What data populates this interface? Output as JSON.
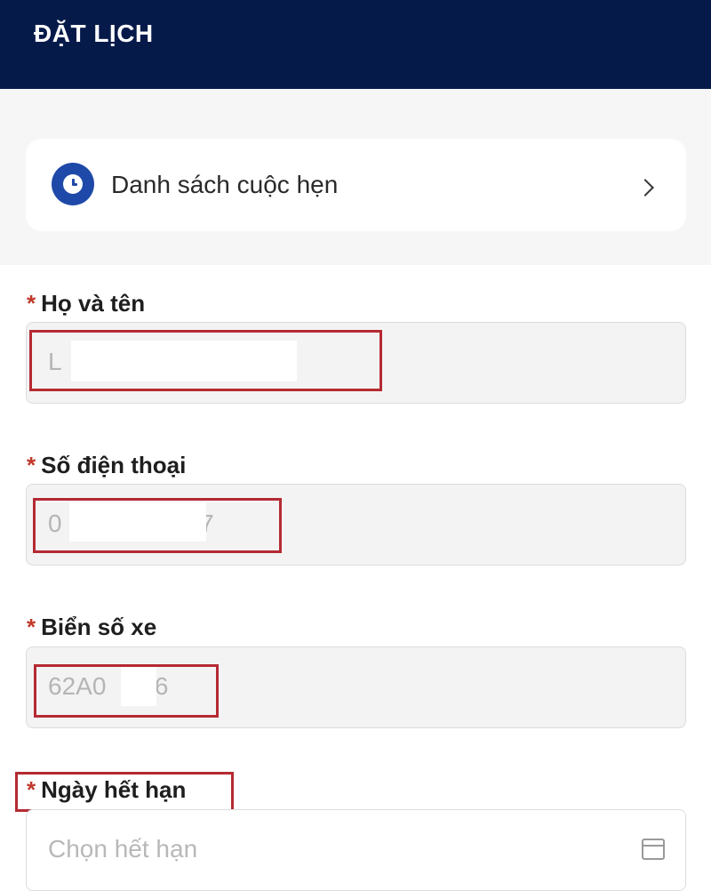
{
  "header": {
    "title": "ĐẶT LỊCH"
  },
  "appointments": {
    "label": "Danh sách cuộc hẹn"
  },
  "form": {
    "required_mark": "*",
    "full_name": {
      "label": "Họ và tên",
      "value": "L                                t"
    },
    "phone": {
      "label": "Số điện thoại",
      "value": "0                    7"
    },
    "plate": {
      "label": "Biển số xe",
      "value": "62A0     76"
    },
    "expiry": {
      "label": "Ngày hết hạn",
      "placeholder": "Chọn hết hạn"
    }
  },
  "colors": {
    "header_bg": "#061a4a",
    "accent_blue": "#1f49a8",
    "required_red": "#c0392b",
    "highlight_red": "#b52a32"
  }
}
